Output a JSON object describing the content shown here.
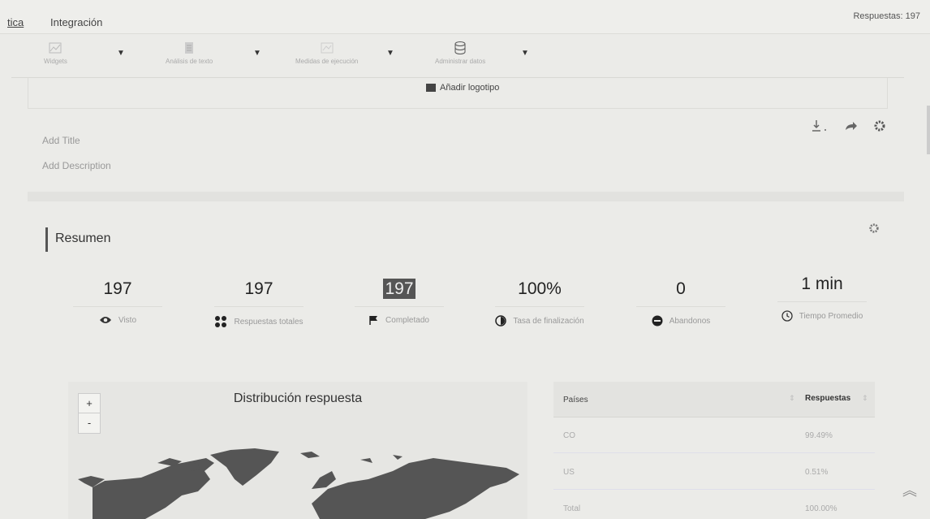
{
  "topbar": {
    "tab_analytics": "tica",
    "tab_integration": "Integración",
    "responses_count": "Respuestas: 197"
  },
  "toolbar": {
    "tools": [
      {
        "icon": "chart-icon",
        "label": "Widgets"
      },
      {
        "icon": "text-analysis-icon",
        "label": "Análisis de texto"
      },
      {
        "icon": "execution-metrics-icon",
        "label": "Medidas de ejecución"
      },
      {
        "icon": "database-icon",
        "label": "Administrar datos"
      }
    ]
  },
  "header": {
    "add_logo": "Añadir logotipo",
    "add_title": "Add Title",
    "add_description": "Add Description"
  },
  "summary": {
    "title": "Resumen",
    "stats": [
      {
        "value": "197",
        "label": "Visto",
        "icon": "eye-icon"
      },
      {
        "value": "197",
        "label": "Respuestas totales",
        "icon": "grid-icon"
      },
      {
        "value": "197",
        "label": "Completado",
        "icon": "flag-icon"
      },
      {
        "value": "100%",
        "label": "Tasa de finalización",
        "icon": "half-circle-icon"
      },
      {
        "value": "0",
        "label": "Abandonos",
        "icon": "minus-circle-icon"
      },
      {
        "value": "1 min",
        "label": "Tiempo Promedio",
        "icon": "clock-icon"
      }
    ]
  },
  "map": {
    "title": "Distribución respuesta",
    "zoom_in": "+",
    "zoom_out": "-"
  },
  "table": {
    "col_country": "Países",
    "col_responses": "Respuestas",
    "rows": [
      {
        "country": "CO",
        "responses": "99.49%"
      },
      {
        "country": "US",
        "responses": "0.51%"
      },
      {
        "country": "Total",
        "responses": "100.00%"
      }
    ]
  },
  "colors": {
    "background": "#ebebe8",
    "highlight": "#555555"
  }
}
